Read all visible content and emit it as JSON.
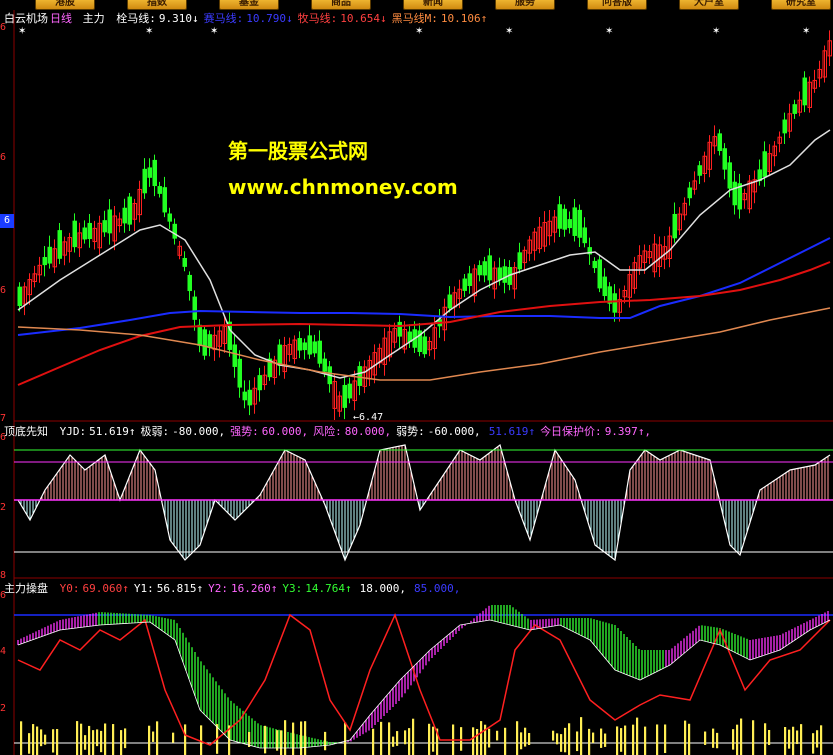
{
  "toolbar": {
    "buttons": [
      "港股",
      "指数",
      "基金",
      "商品",
      "新闻",
      "服务",
      "问答版",
      "大户室",
      "研究室"
    ]
  },
  "main_panel": {
    "stock_name": "白云机场",
    "period": "日线",
    "indicator": "主力",
    "lines": [
      {
        "label": "栓马线:",
        "value": "9.310",
        "arrow": "↓",
        "color": "#ffffff"
      },
      {
        "label": "赛马线:",
        "value": "10.790",
        "arrow": "↓",
        "color": "#3b3bff"
      },
      {
        "label": "牧马线:",
        "value": "10.654",
        "arrow": "↓",
        "color": "#ff4040"
      },
      {
        "label": "黑马线M:",
        "value": "10.106",
        "arrow": "↑",
        "color": "#ff8c40"
      }
    ],
    "low_marker": "6.47",
    "axis_labels": [
      "6",
      "6",
      "6",
      "7"
    ],
    "price_box": "6"
  },
  "watermark": {
    "title": "第一股票公式网",
    "url": "www.chnmoney.com"
  },
  "panel2": {
    "name": "顶底先知",
    "items": [
      {
        "label": "YJD:",
        "value": "51.619",
        "arrow": "↑",
        "color": "#ffffff"
      },
      {
        "label": "极弱:",
        "value": "-80.000,",
        "arrow": "",
        "color": "#ffffff"
      },
      {
        "label": "强势:",
        "value": "60.000,",
        "arrow": "",
        "color": "#ff66ff"
      },
      {
        "label": "风险:",
        "value": "80.000,",
        "arrow": "",
        "color": "#ff66ff"
      },
      {
        "label": "弱势:",
        "value": "-60.000,",
        "arrow": "",
        "color": "#ffffff"
      },
      {
        "label": "",
        "value": "51.619",
        "arrow": "↑",
        "color": "#3b3bff"
      },
      {
        "label": "今日保护价:",
        "value": "9.397",
        "arrow": "↑,",
        "color": "#ff66ff"
      }
    ],
    "axis_labels": [
      "6",
      "2",
      "8"
    ]
  },
  "panel3": {
    "name": "主力操盘",
    "items": [
      {
        "label": "Y0:",
        "value": "69.060",
        "arrow": "↑",
        "color": "#ff4040"
      },
      {
        "label": "Y1:",
        "value": "56.815",
        "arrow": "↑",
        "color": "#ffffff"
      },
      {
        "label": "Y2:",
        "value": "16.260",
        "arrow": "↑",
        "color": "#ff66ff"
      },
      {
        "label": "Y3:",
        "value": "14.764",
        "arrow": "↑",
        "color": "#33ff33"
      },
      {
        "label": "",
        "value": "18.000,",
        "arrow": "",
        "color": "#ffffff"
      },
      {
        "label": "",
        "value": "85.000,",
        "arrow": "",
        "color": "#3b3bff"
      }
    ],
    "axis_labels": [
      "6",
      "4",
      "2"
    ]
  },
  "colors": {
    "up": "#ff2020",
    "down": "#22ff22",
    "ma_short": "#e0e0e0",
    "ma_blue": "#1a2cff",
    "ma_red": "#e01010",
    "ma_orange": "#e08850",
    "magenta": "#ff33ff",
    "yellow": "#ffee55",
    "grid": "#8b0000"
  }
}
